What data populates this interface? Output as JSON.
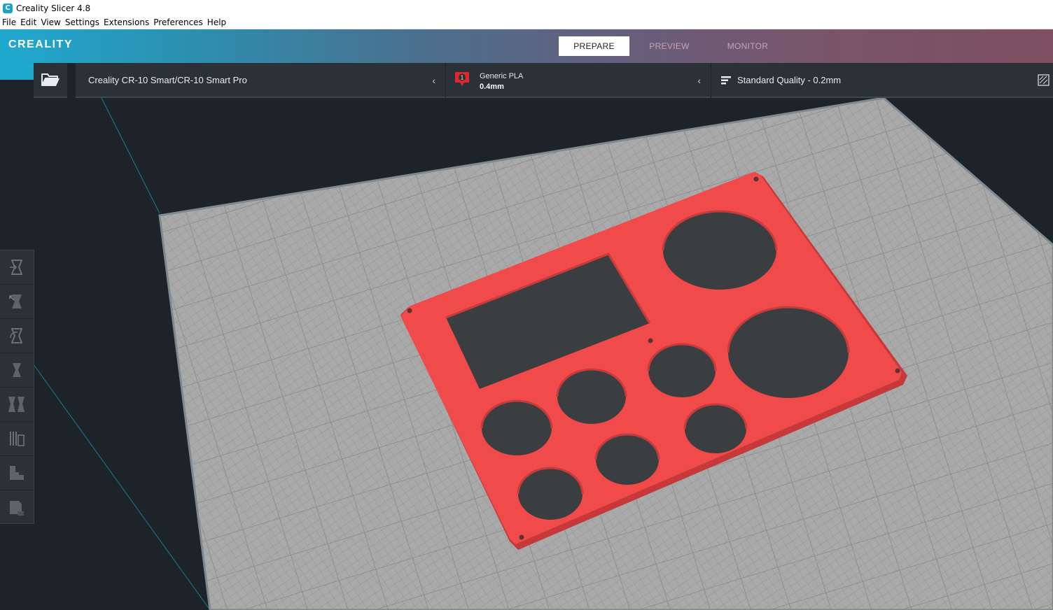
{
  "window": {
    "title": "Creality Slicer 4.8",
    "app_icon_glyph": "C"
  },
  "menu": [
    "File",
    "Edit",
    "View",
    "Settings",
    "Extensions",
    "Preferences",
    "Help"
  ],
  "header": {
    "logo": "CREALITY",
    "stages": {
      "prepare": "PREPARE",
      "preview": "PREVIEW",
      "monitor": "MONITOR"
    },
    "active_stage": "PREPARE"
  },
  "toolbar": {
    "printer": "Creality CR-10 Smart/CR-10 Smart Pro",
    "material": {
      "extruder_number": "1",
      "name": "Generic PLA",
      "nozzle": "0.4mm",
      "color": "#e0262f"
    },
    "quality": "Standard Quality - 0.2mm",
    "chevron": "‹"
  },
  "tools": [
    {
      "name": "move-tool-icon"
    },
    {
      "name": "scale-tool-icon"
    },
    {
      "name": "rotate-tool-icon"
    },
    {
      "name": "mirror-tool-icon"
    },
    {
      "name": "per-model-settings-icon"
    },
    {
      "name": "support-blocker-icon"
    },
    {
      "name": "layer-view-icon"
    },
    {
      "name": "custom-support-icon"
    }
  ],
  "model": {
    "color": "#f04a4a",
    "hole_color": "#3a3d40"
  },
  "colors": {
    "accent": "#20a9cf",
    "build_plate": "#a9a9a9",
    "background": "#1d2429"
  }
}
